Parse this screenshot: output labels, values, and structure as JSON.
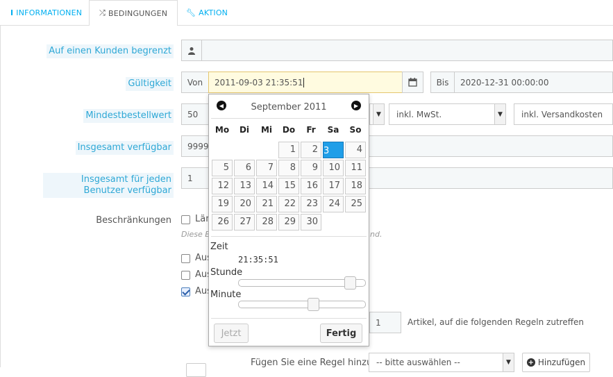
{
  "tabs": [
    {
      "label": "Informationen",
      "icon": "info-icon"
    },
    {
      "label": "Bedingungen",
      "icon": "shuffle-icon"
    },
    {
      "label": "Aktion",
      "icon": "wrench-icon"
    }
  ],
  "form": {
    "customer_label": "Auf einen Kunden begrenzt",
    "customer_value": "",
    "validity_label": "Gültigkeit",
    "from_label": "Von",
    "from_value": "2011-09-03 21:35:51",
    "to_label": "Bis",
    "to_value": "2020-12-31 00:00:00",
    "min_order_label": "Mindestbestellwert",
    "min_order_value": "50",
    "tax_option": "inkl. MwSt.",
    "shipping_option": "inkl. Versandkosten",
    "total_available_label": "Insgesamt verfügbar",
    "total_available_value": "99999",
    "per_user_label": "Insgesamt für jeden Benutzer verfügbar",
    "per_user_value": "1",
    "restrictions_label": "Beschränkungen",
    "restriction_1": "Län",
    "restriction_hint_start": "Diese B",
    "restriction_hint_end": "nd.",
    "restriction_2": "Aus",
    "restriction_3": "Aus",
    "restriction_4": "Aus",
    "restriction_4_checked": true,
    "rules_count": "1",
    "rules_text": "Artikel, auf die folgenden Regeln zutreffen",
    "add_rule_label": "Fügen Sie eine Regel hinzu",
    "add_rule_select": "-- bitte auswählen --",
    "add_button": "Hinzufügen"
  },
  "datepicker": {
    "month_title": "September 2011",
    "weekdays": [
      "Mo",
      "Di",
      "Mi",
      "Do",
      "Fr",
      "Sa",
      "So"
    ],
    "selected_day": "3",
    "weeks": [
      [
        "",
        "",
        "",
        "1",
        "2",
        "3",
        "4"
      ],
      [
        "5",
        "6",
        "7",
        "8",
        "9",
        "10",
        "11"
      ],
      [
        "12",
        "13",
        "14",
        "15",
        "16",
        "17",
        "18"
      ],
      [
        "19",
        "20",
        "21",
        "22",
        "23",
        "24",
        "25"
      ],
      [
        "26",
        "27",
        "28",
        "29",
        "30",
        "",
        ""
      ]
    ],
    "time_label": "Zeit",
    "time_value": "21:35:51",
    "hour_label": "Stunde",
    "hour_value": 21,
    "minute_label": "Minute",
    "minute_value": 35,
    "now_button": "Jetzt",
    "done_button": "Fertig"
  }
}
